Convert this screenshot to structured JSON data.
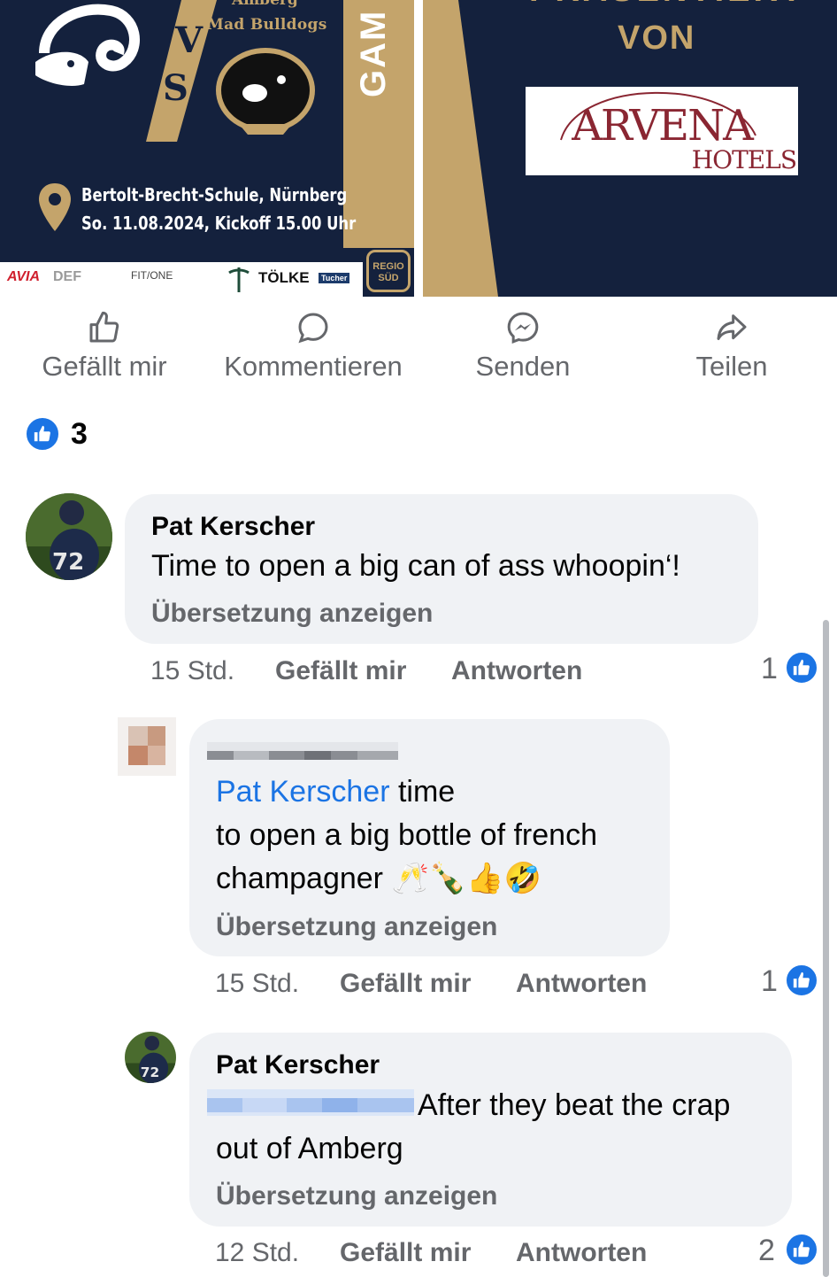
{
  "post_image": {
    "left": {
      "team_top_partial": "Amberg",
      "team_name": "Mad Bulldogs",
      "vs_v": "V",
      "vs_s": "S",
      "vertical_text": "GAM",
      "venue_line1": "Bertolt-Brecht-Schule, Nürnberg",
      "venue_line2": "So. 11.08.2024, Kickoff 15.00 Uhr",
      "sponsors": [
        "AVIA",
        "DEF",
        "FIT/ONE",
        "TÖLKE",
        "Tucher"
      ],
      "regio_badge": "REGIO SÜD"
    },
    "right": {
      "top_partial": "PRÄSENTIERT",
      "von": "VON",
      "logo_main": "ARVENA",
      "logo_sub": "HOTELS"
    }
  },
  "actions": {
    "like": "Gefällt mir",
    "comment": "Kommentieren",
    "send": "Senden",
    "share": "Teilen"
  },
  "reactions": {
    "count": "3"
  },
  "comments": [
    {
      "author": "Pat Kerscher",
      "text": "Time to open a big can of ass whoopin‘!",
      "translate": "Übersetzung anzeigen",
      "time": "15 Std.",
      "like": "Gefällt mir",
      "reply": "Antworten",
      "reaction_count": "1"
    },
    {
      "author": "",
      "mention": "Pat Kerscher",
      "text_first": " time",
      "text_line2": "to open a big bottle of french",
      "text_line3": "champagner 🥂🍾👍🤣",
      "translate": "Übersetzung anzeigen",
      "time": "15 Std.",
      "like": "Gefällt mir",
      "reply": "Antworten",
      "reaction_count": "1"
    },
    {
      "author": "Pat Kerscher",
      "text_line1": "After they beat the crap",
      "text_line2": "out of Amberg",
      "translate": "Übersetzung anzeigen",
      "time": "12 Std.",
      "like": "Gefällt mir",
      "reply": "Antworten",
      "reaction_count": "2"
    }
  ],
  "colors": {
    "navy": "#14213d",
    "gold": "#c4a46b",
    "facebook_blue": "#1b74e4",
    "bubble": "#f0f2f5",
    "secondary_text": "#65676b",
    "arvena_red": "#8a2632"
  }
}
